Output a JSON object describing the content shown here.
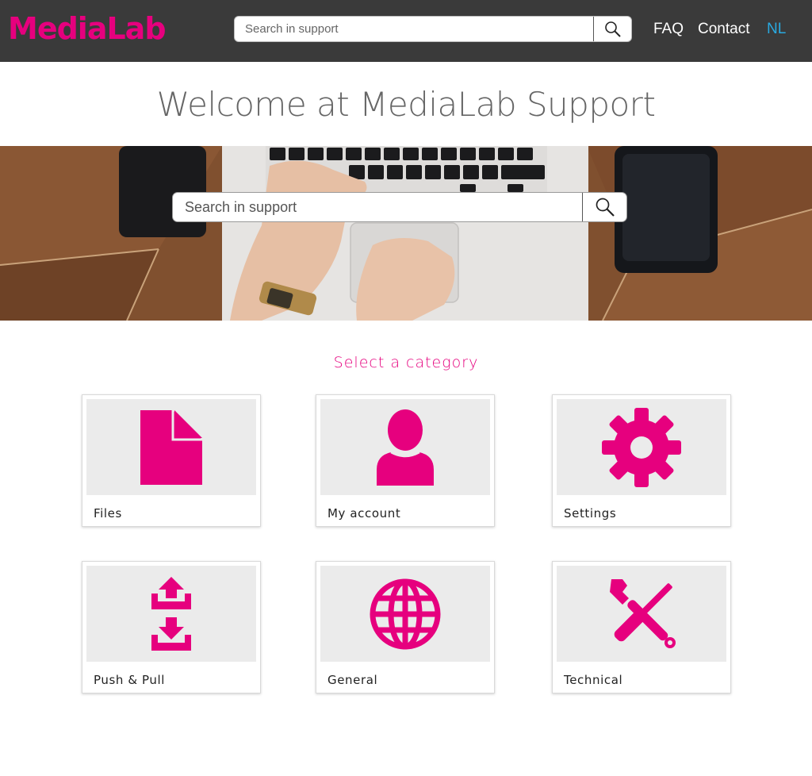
{
  "header": {
    "logo": "MediaLab",
    "search_placeholder": "Search in support",
    "nav": {
      "faq": "FAQ",
      "contact": "Contact",
      "language": "NL"
    }
  },
  "welcome_title": "Welcome at MediaLab Support",
  "hero": {
    "search_placeholder": "Search in support"
  },
  "categories": {
    "heading": "Select a category",
    "items": [
      {
        "label": "Files",
        "icon": "file-icon"
      },
      {
        "label": "My account",
        "icon": "user-icon"
      },
      {
        "label": "Settings",
        "icon": "gear-icon"
      },
      {
        "label": "Push & Pull",
        "icon": "upload-download-icon"
      },
      {
        "label": "General",
        "icon": "globe-icon"
      },
      {
        "label": "Technical",
        "icon": "tools-icon"
      }
    ]
  },
  "colors": {
    "brand": "#e6007e",
    "header_bg": "#3a3a3a",
    "language_link": "#29a9e0",
    "card_image_bg": "#ebebeb"
  }
}
